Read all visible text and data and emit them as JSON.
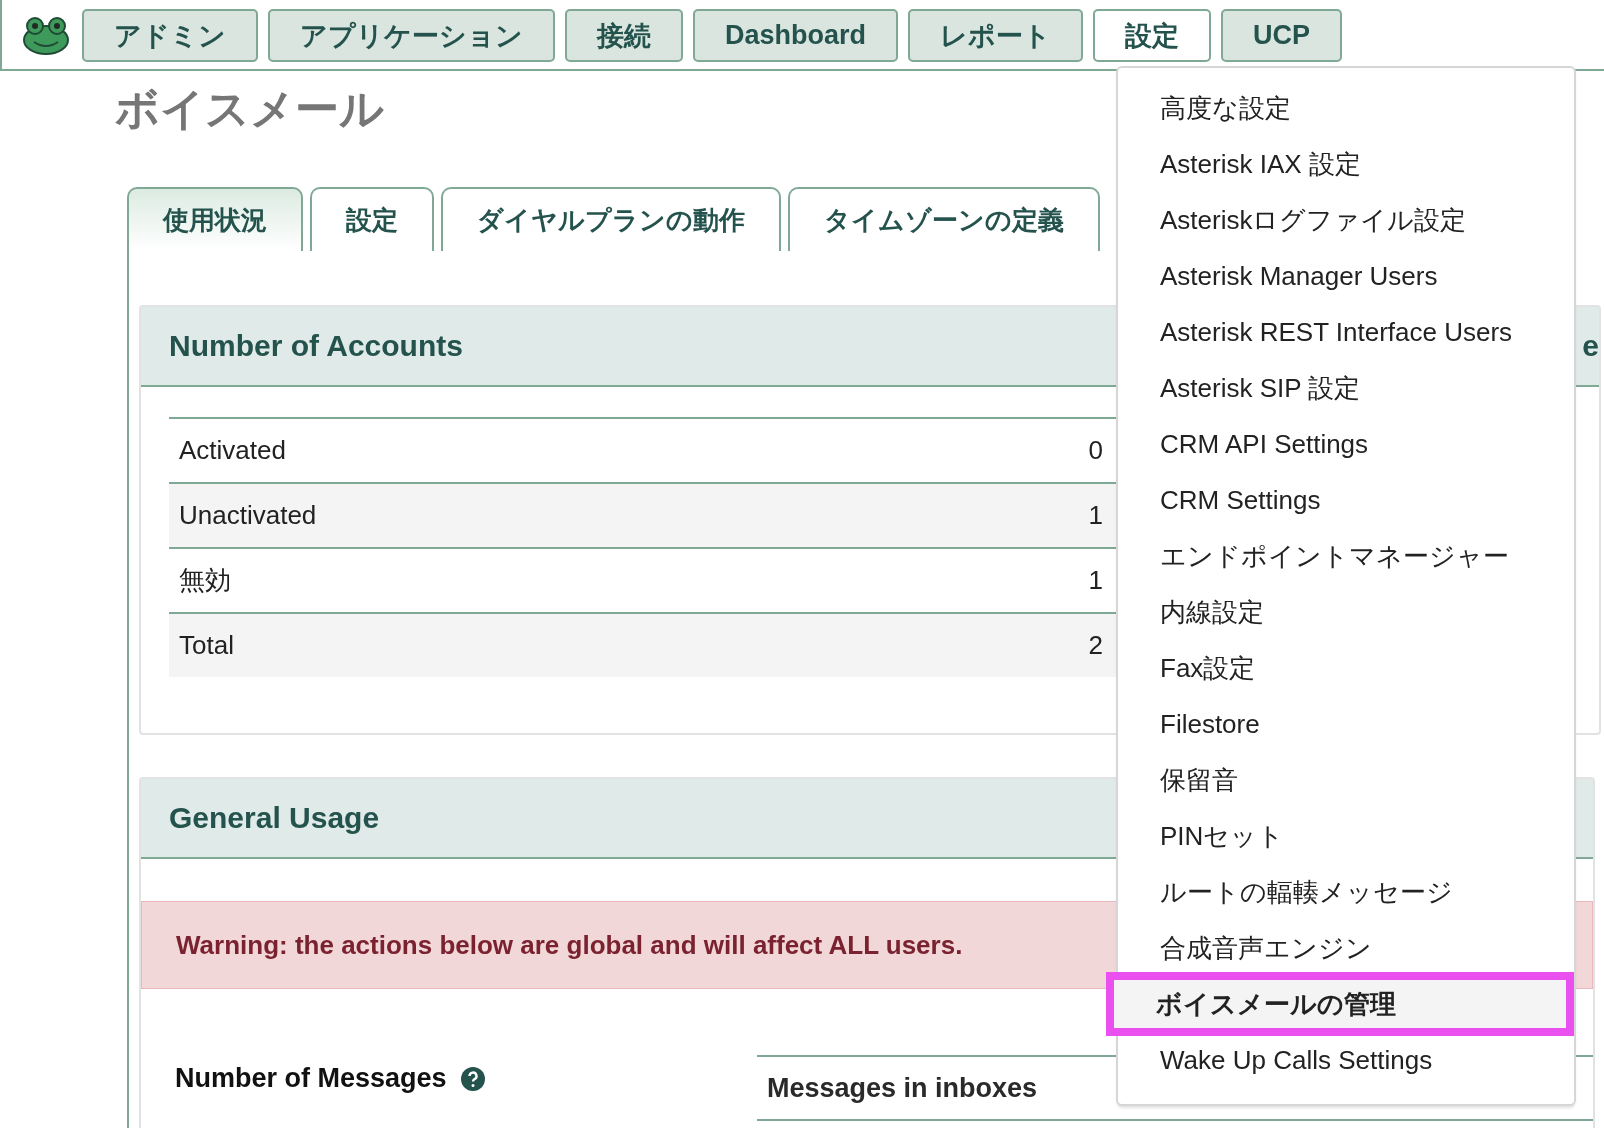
{
  "nav": [
    {
      "label": "アドミン",
      "selected": false
    },
    {
      "label": "アプリケーション",
      "selected": false
    },
    {
      "label": "接続",
      "selected": false
    },
    {
      "label": "Dashboard",
      "selected": false
    },
    {
      "label": "レポート",
      "selected": false
    },
    {
      "label": "設定",
      "selected": true
    },
    {
      "label": "UCP",
      "selected": false
    }
  ],
  "page_title": "ボイスメール",
  "tabs": [
    {
      "label": "使用状況",
      "selected": true
    },
    {
      "label": "設定",
      "selected": false
    },
    {
      "label": "ダイヤルプランの動作",
      "selected": false
    },
    {
      "label": "タイムゾーンの定義",
      "selected": false
    }
  ],
  "accounts_panel": {
    "title": "Number of Accounts",
    "rows": [
      {
        "label": "Activated",
        "value": "0"
      },
      {
        "label": "Unactivated",
        "value": "1"
      },
      {
        "label": "無効",
        "value": "1"
      },
      {
        "label": "Total",
        "value": "2"
      }
    ]
  },
  "right_panel": {
    "title": "e"
  },
  "general_panel": {
    "title": "General Usage",
    "warning": "Warning: the actions below are global and will affect ALL users.",
    "messages_label": "Number of Messages",
    "messages_column": "Messages in inboxes"
  },
  "menu": {
    "items": [
      {
        "label": "高度な設定",
        "selected": false
      },
      {
        "label": "Asterisk IAX 設定",
        "selected": false
      },
      {
        "label": "Asteriskログファイル設定",
        "selected": false
      },
      {
        "label": "Asterisk Manager Users",
        "selected": false
      },
      {
        "label": "Asterisk REST Interface Users",
        "selected": false
      },
      {
        "label": "Asterisk SIP 設定",
        "selected": false
      },
      {
        "label": "CRM API Settings",
        "selected": false
      },
      {
        "label": "CRM Settings",
        "selected": false
      },
      {
        "label": "エンドポイントマネージャー",
        "selected": false
      },
      {
        "label": "内線設定",
        "selected": false
      },
      {
        "label": "Fax設定",
        "selected": false
      },
      {
        "label": "Filestore",
        "selected": false
      },
      {
        "label": "保留音",
        "selected": false
      },
      {
        "label": "PINセット",
        "selected": false
      },
      {
        "label": "ルートの輻輳メッセージ",
        "selected": false
      },
      {
        "label": "合成音声エンジン",
        "selected": false
      },
      {
        "label": "ボイスメールの管理",
        "selected": true
      },
      {
        "label": "Wake Up Calls Settings",
        "selected": false
      }
    ]
  }
}
